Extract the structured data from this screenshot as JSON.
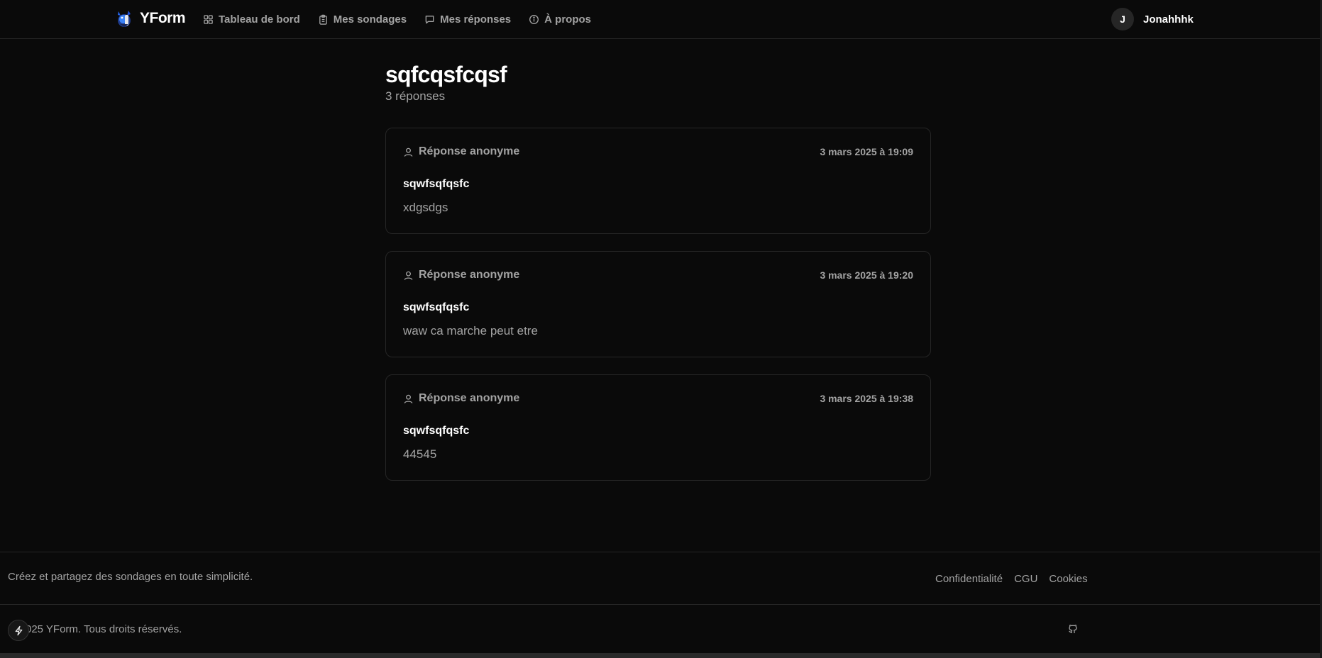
{
  "header": {
    "brand": "YForm",
    "nav": [
      {
        "label": "Tableau de bord",
        "icon": "grid-icon"
      },
      {
        "label": "Mes sondages",
        "icon": "clipboard-icon"
      },
      {
        "label": "Mes réponses",
        "icon": "message-icon"
      },
      {
        "label": "À propos",
        "icon": "info-icon"
      }
    ],
    "user": {
      "initial": "J",
      "name": "Jonahhhk"
    }
  },
  "main": {
    "title": "sqfcqsfcqsf",
    "subtitle": "3 réponses",
    "responses": [
      {
        "respondent": "Réponse anonyme",
        "date": "3 mars 2025 à 19:09",
        "question": "sqwfsqfqsfc",
        "answer": "xdgsdgs"
      },
      {
        "respondent": "Réponse anonyme",
        "date": "3 mars 2025 à 19:20",
        "question": "sqwfsqfqsfc",
        "answer": "waw ca marche peut etre"
      },
      {
        "respondent": "Réponse anonyme",
        "date": "3 mars 2025 à 19:38",
        "question": "sqwfsqfqsfc",
        "answer": "44545"
      }
    ]
  },
  "footer": {
    "tagline": "Créez et partagez des sondages en toute simplicité.",
    "links": [
      "Confidentialité",
      "CGU",
      "Cookies"
    ],
    "copyright": "025 YForm. Tous droits réservés."
  },
  "colors": {
    "background": "#0a0a0a",
    "border": "#262626",
    "text_primary": "#ffffff",
    "text_muted": "#a3a3a3",
    "brand_blue": "#3b82f6"
  }
}
